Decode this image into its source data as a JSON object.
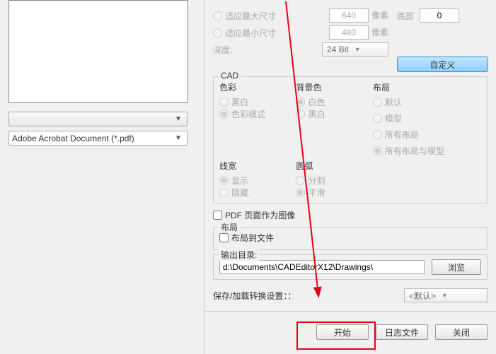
{
  "left": {
    "dropdown1_value": "",
    "dropdown2_value": "Adobe Acrobat Document (*.pdf)"
  },
  "top": {
    "max_size_label": "适应最大尺寸",
    "max_size_value": "640",
    "min_size_label": "适应最小尺寸",
    "min_size_value": "480",
    "unit": "像素",
    "depth_label": "深度:",
    "depth_value": "24 Bit",
    "bottom_label": "底部",
    "bottom_value": "0",
    "custom_btn": "自定义"
  },
  "cad": {
    "group_title": "CAD",
    "color_title": "色彩",
    "color_bw": "黑白",
    "color_mode": "色彩模式",
    "bg_title": "背景色",
    "bg_white": "白色",
    "bg_black": "黑白",
    "layout_title": "布局",
    "layout_default": "默认",
    "layout_model": "模型",
    "layout_all": "所有布局",
    "layout_all_model": "所有布局与模型",
    "lw_title": "线宽",
    "lw_show": "显示",
    "lw_hide": "隐藏",
    "arc_title": "圆弧",
    "arc_split": "分割",
    "arc_smooth": "平滑"
  },
  "pdf_as_image": "PDF 页面作为图像",
  "layout_group": {
    "title": "布局",
    "to_file": "布局到文件"
  },
  "output": {
    "label": "输出目录:",
    "path": "d:\\Documents\\CADEditorX12\\Drawings\\",
    "browse": "浏览"
  },
  "settings": {
    "label": "保存/加载转换设置：：",
    "combo": "<默认>"
  },
  "buttons": {
    "start": "开始",
    "log": "日志文件",
    "close": "关闭"
  }
}
